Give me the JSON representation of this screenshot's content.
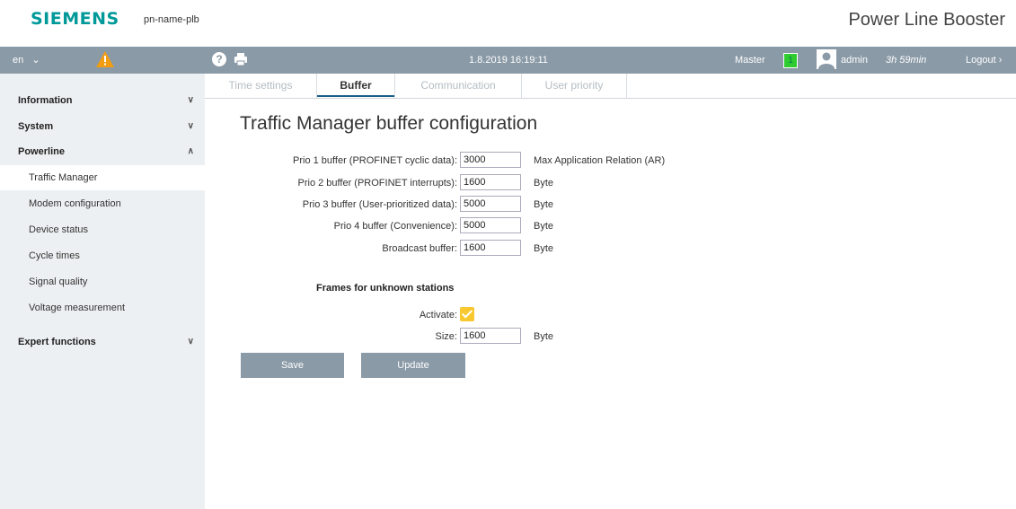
{
  "header": {
    "brand": "SIEMENS",
    "device_name": "pn-name-plb",
    "product": "Power Line Booster"
  },
  "navbar": {
    "language": "en",
    "language_arrow": "⌄",
    "datetime": "1.8.2019 16:19:11",
    "role": "Master",
    "master_badge": "1",
    "user": "admin",
    "session_time": "3h 59min",
    "logout": "Logout ›",
    "help_glyph": "?"
  },
  "sidebar": {
    "information": "Information",
    "system": "System",
    "powerline": "Powerline",
    "sub": {
      "traffic_manager": "Traffic Manager",
      "modem_configuration": "Modem configuration",
      "device_status": "Device status",
      "cycle_times": "Cycle times",
      "signal_quality": "Signal quality",
      "voltage_measurement": "Voltage measurement"
    },
    "expert": "Expert functions",
    "chev_down": "∨",
    "chev_up": "∧"
  },
  "tabs": {
    "time_settings": "Time settings",
    "buffer": "Buffer",
    "communication": "Communication",
    "user_priority": "User priority"
  },
  "main": {
    "title": "Traffic Manager buffer configuration",
    "prio1": {
      "label": "Prio 1 buffer (PROFINET cyclic data):",
      "value": "3000",
      "unit": "Max Application Relation (AR)"
    },
    "prio2": {
      "label": "Prio 2 buffer (PROFINET interrupts):",
      "value": "1600",
      "unit": "Byte"
    },
    "prio3": {
      "label": "Prio 3 buffer (User-prioritized data):",
      "value": "5000",
      "unit": "Byte"
    },
    "prio4": {
      "label": "Prio 4 buffer (Convenience):",
      "value": "5000",
      "unit": "Byte"
    },
    "broadcast": {
      "label": "Broadcast buffer:",
      "value": "1600",
      "unit": "Byte"
    },
    "unknown_section": "Frames for unknown stations",
    "activate_label": "Activate:",
    "activate_checked": true,
    "size": {
      "label": "Size:",
      "value": "1600",
      "unit": "Byte"
    },
    "save": "Save",
    "update": "Update"
  },
  "colors": {
    "brand": "#009999",
    "navbar": "#8a9aa7",
    "sidebar_bg": "#edf0f2",
    "warning": "#f39c12",
    "master_badge": "#2ecc2e",
    "checkbox": "#f7c830",
    "tab_indicator": "#1a5e8a"
  }
}
